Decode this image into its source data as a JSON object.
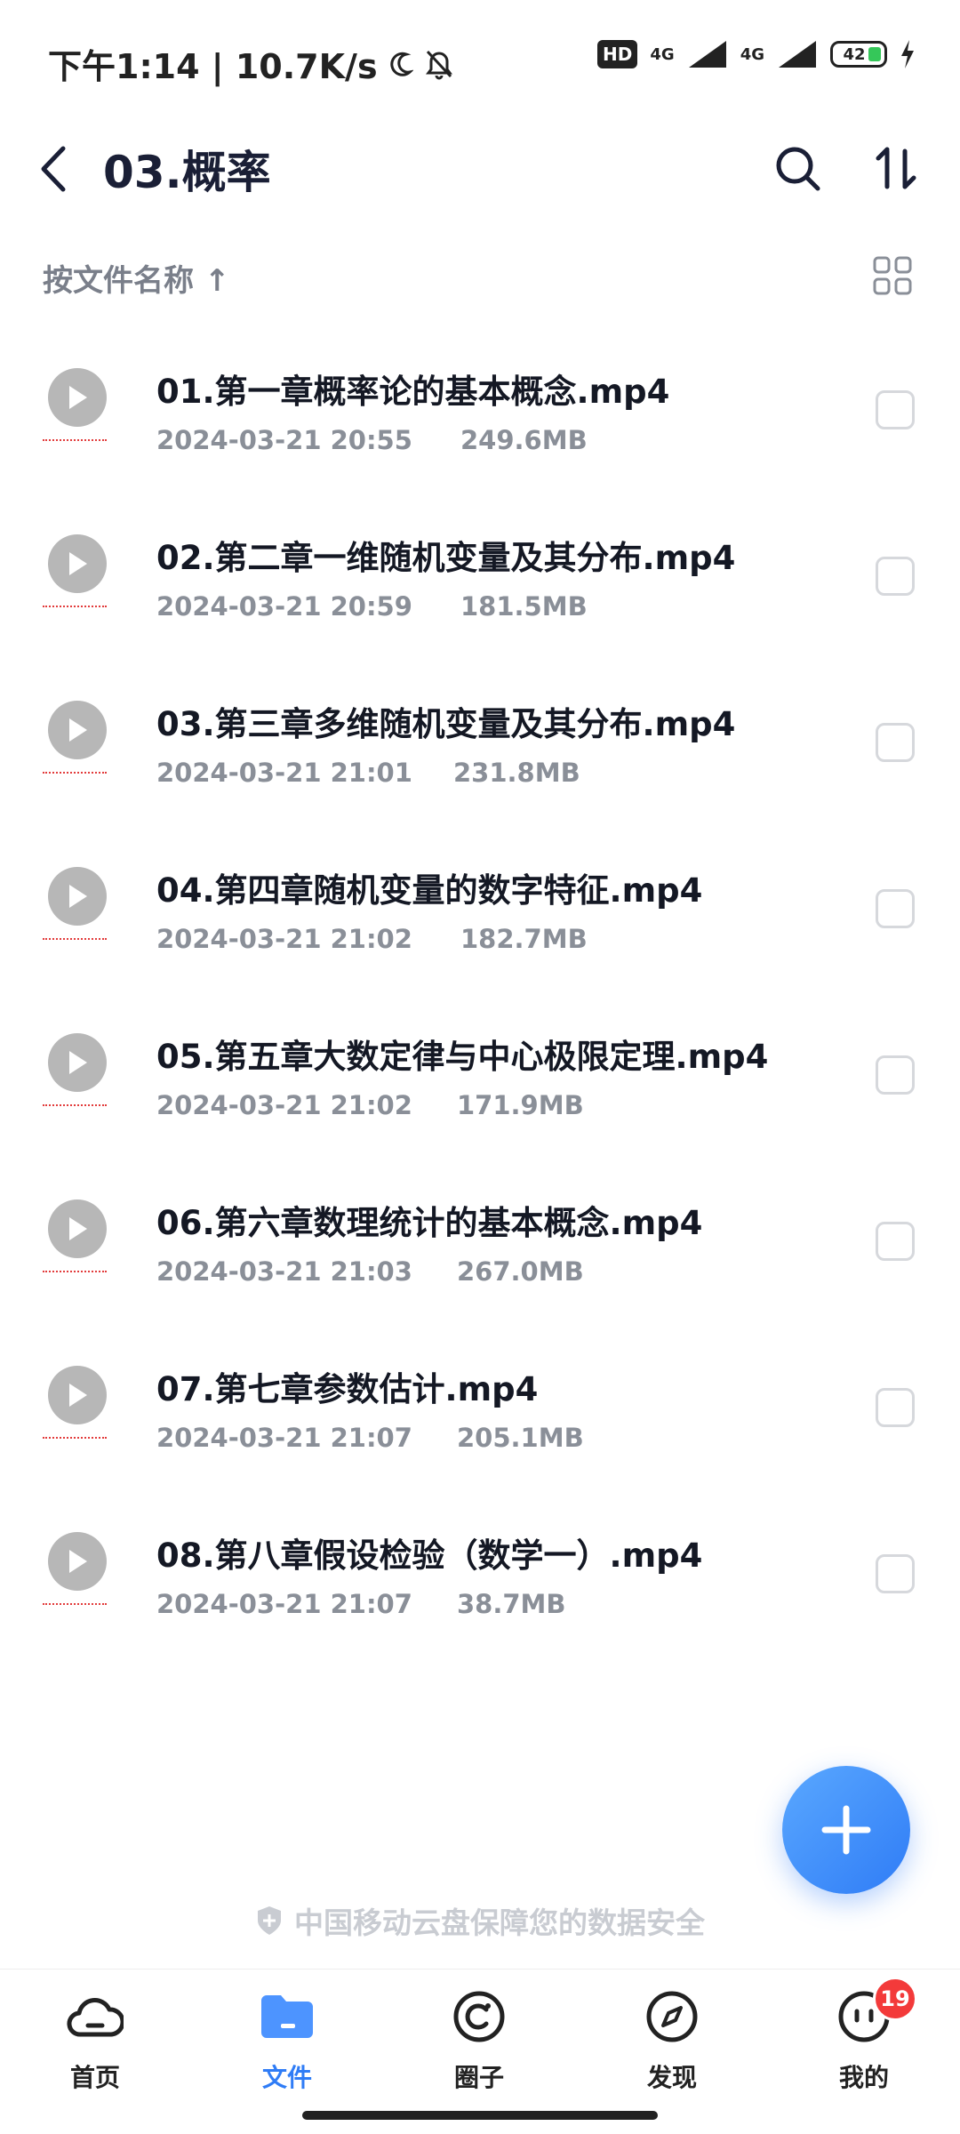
{
  "status_bar": {
    "time": "下午1:14 | 10.7K/s",
    "network_1": "4G",
    "network_2": "4G",
    "hd_label": "HD",
    "battery": "42"
  },
  "header": {
    "title": "03.概率"
  },
  "sort": {
    "label": "按文件名称 ↑"
  },
  "files": [
    {
      "name": "01.第一章概率论的基本概念.mp4",
      "date": "2024-03-21 20:55",
      "size": "249.6MB"
    },
    {
      "name": "02.第二章一维随机变量及其分布.mp4",
      "date": "2024-03-21 20:59",
      "size": "181.5MB"
    },
    {
      "name": "03.第三章多维随机变量及其分布.mp4",
      "date": "2024-03-21 21:01",
      "size": "231.8MB"
    },
    {
      "name": "04.第四章随机变量的数字特征.mp4",
      "date": "2024-03-21 21:02",
      "size": "182.7MB"
    },
    {
      "name": "05.第五章大数定律与中心极限定理.mp4",
      "date": "2024-03-21 21:02",
      "size": "171.9MB"
    },
    {
      "name": "06.第六章数理统计的基本概念.mp4",
      "date": "2024-03-21 21:03",
      "size": "267.0MB"
    },
    {
      "name": "07.第七章参数估计.mp4",
      "date": "2024-03-21 21:07",
      "size": "205.1MB"
    },
    {
      "name": "08.第八章假设检验（数学一）.mp4",
      "date": "2024-03-21 21:07",
      "size": "38.7MB"
    }
  ],
  "security_note": "中国移动云盘保障您的数据安全",
  "nav": {
    "home": "首页",
    "files": "文件",
    "circle": "圈子",
    "discover": "发现",
    "mine": "我的",
    "mine_badge": "19"
  },
  "colors": {
    "accent": "#2f7cf6",
    "badge": "#f33a3a"
  }
}
